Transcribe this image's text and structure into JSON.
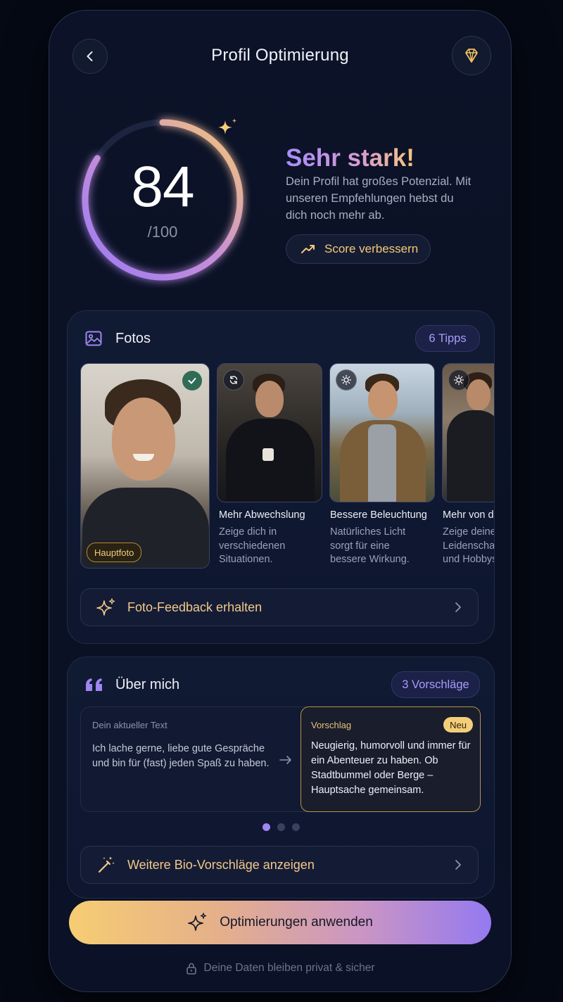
{
  "header": {
    "title": "Profil Optimierung"
  },
  "score": {
    "value": "84",
    "max": "/100",
    "fraction": 0.84,
    "verdict": "Sehr stark!",
    "description": "Dein Profil hat großes Potenzial. Mit unseren Empfehlungen hebst du dich noch mehr ab.",
    "improve_label": "Score verbessern"
  },
  "photos": {
    "title": "Fotos",
    "badge": "6 Tipps",
    "main_label": "Hauptfoto",
    "tips": [
      {
        "title": "Mehr Abwechslung",
        "desc": "Zeige dich in verschiedenen Situationen.",
        "icon": "refresh-icon"
      },
      {
        "title": "Bessere Beleuchtung",
        "desc": "Natürliches Licht sorgt für eine bessere Wirkung.",
        "icon": "sun-icon"
      },
      {
        "title": "Mehr von dir",
        "desc": "Zeige deine Leidenschaft und Hobbys.",
        "icon": "sun-icon"
      }
    ],
    "feedback_label": "Foto-Feedback erhalten"
  },
  "about": {
    "title": "Über mich",
    "badge": "3 Vorschläge",
    "current_label": "Dein aktueller Text",
    "current_text": "Ich lache gerne, liebe gute Gespräche und bin für (fast) jeden Spaß zu haben.",
    "suggestion_label": "Vorschlag",
    "new_badge": "Neu",
    "suggestion_text": "Neugierig, humorvoll und immer für ein Abenteuer zu haben. Ob Stadtbummel oder Berge – Hauptsache gemeinsam.",
    "more_label": "Weitere Bio-Vorschläge anzeigen"
  },
  "cta": {
    "label": "Optimierungen anwenden"
  },
  "footer": {
    "privacy": "Deine Daten bleiben privat & sicher"
  },
  "colors": {
    "accent_purple": "#9f86f2",
    "accent_gold": "#f5c978",
    "background": "#0b1226"
  }
}
